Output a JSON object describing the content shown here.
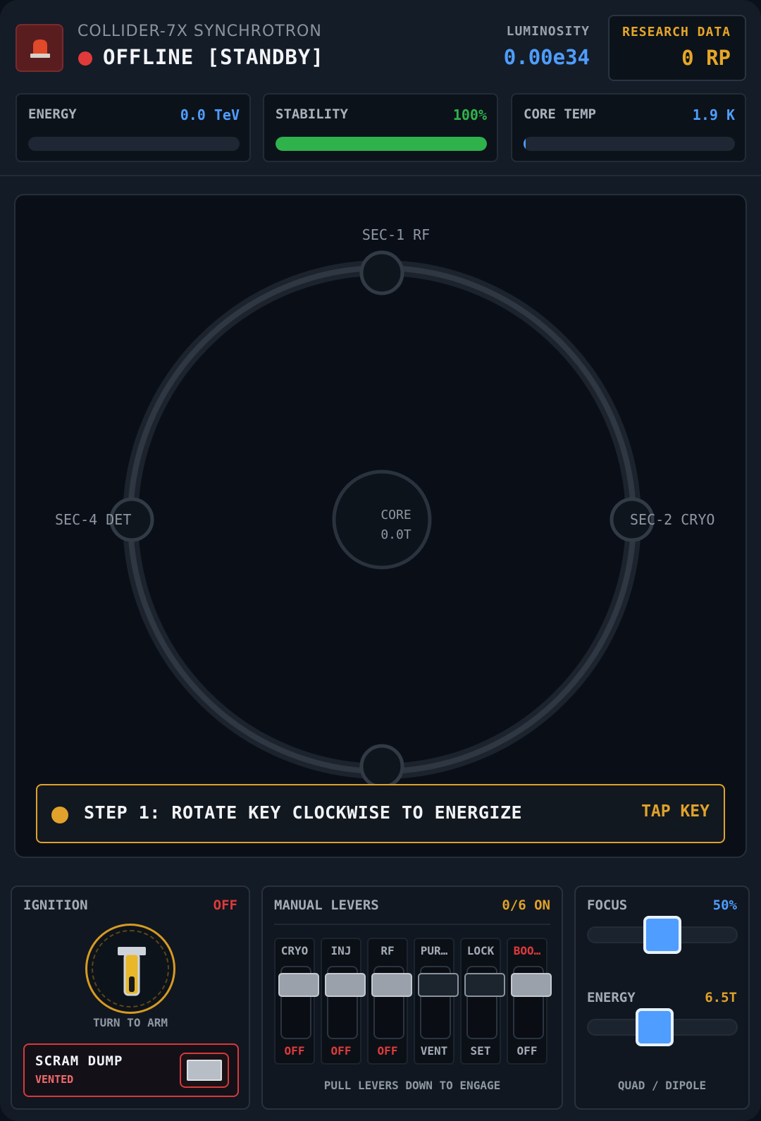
{
  "header": {
    "facility": "COLLIDER-7X SYNCHROTRON",
    "status": "OFFLINE [STANDBY]",
    "luminosity_label": "LUMINOSITY",
    "luminosity_value": "0.00e34",
    "research_label": "RESEARCH DATA",
    "research_value": "0 RP"
  },
  "meters": [
    {
      "label": "ENERGY",
      "value": "0.0 TeV",
      "level": 0.0,
      "color": "#4f9dff"
    },
    {
      "label": "STABILITY",
      "value": "100%",
      "level": 1.0,
      "color": "#2fb24c"
    },
    {
      "label": "CORE TEMP",
      "value": "1.9 K",
      "level": 0.005,
      "color": "#4f9dff"
    }
  ],
  "ring": {
    "sectors": {
      "top": "SEC-1 RF",
      "right": "SEC-2 CRYO",
      "left": "SEC-4 DET"
    },
    "core_label": "CORE",
    "core_value": "0.0T"
  },
  "step": {
    "text": "STEP 1: ROTATE KEY CLOCKWISE TO ENERGIZE",
    "action": "TAP KEY"
  },
  "ignition": {
    "title": "IGNITION",
    "status": "OFF",
    "turn_label": "TURN TO ARM",
    "scram_title": "SCRAM DUMP",
    "scram_sub": "VENTED"
  },
  "levers": {
    "title": "MANUAL LEVERS",
    "count": "0/6 ON",
    "hint": "PULL LEVERS DOWN TO ENGAGE",
    "items": [
      {
        "name": "CRYO",
        "state": "OFF"
      },
      {
        "name": "INJ",
        "state": "OFF"
      },
      {
        "name": "RF",
        "state": "OFF"
      },
      {
        "name": "PUR…",
        "state": "VENT"
      },
      {
        "name": "LOCK",
        "state": "SET"
      },
      {
        "name": "BOO…",
        "state": "OFF"
      }
    ]
  },
  "sliders": {
    "focus_label": "FOCUS",
    "focus_value": "50%",
    "focus_level": 0.5,
    "energy_label": "ENERGY",
    "energy_value": "6.5T",
    "energy_level": 0.45,
    "mode_label": "QUAD / DIPOLE"
  },
  "colors": {
    "accent_blue": "#4f9dff",
    "warning_amber": "#e0a22a",
    "alarm_red": "#e03a3a",
    "ok_green": "#2fb24c"
  }
}
